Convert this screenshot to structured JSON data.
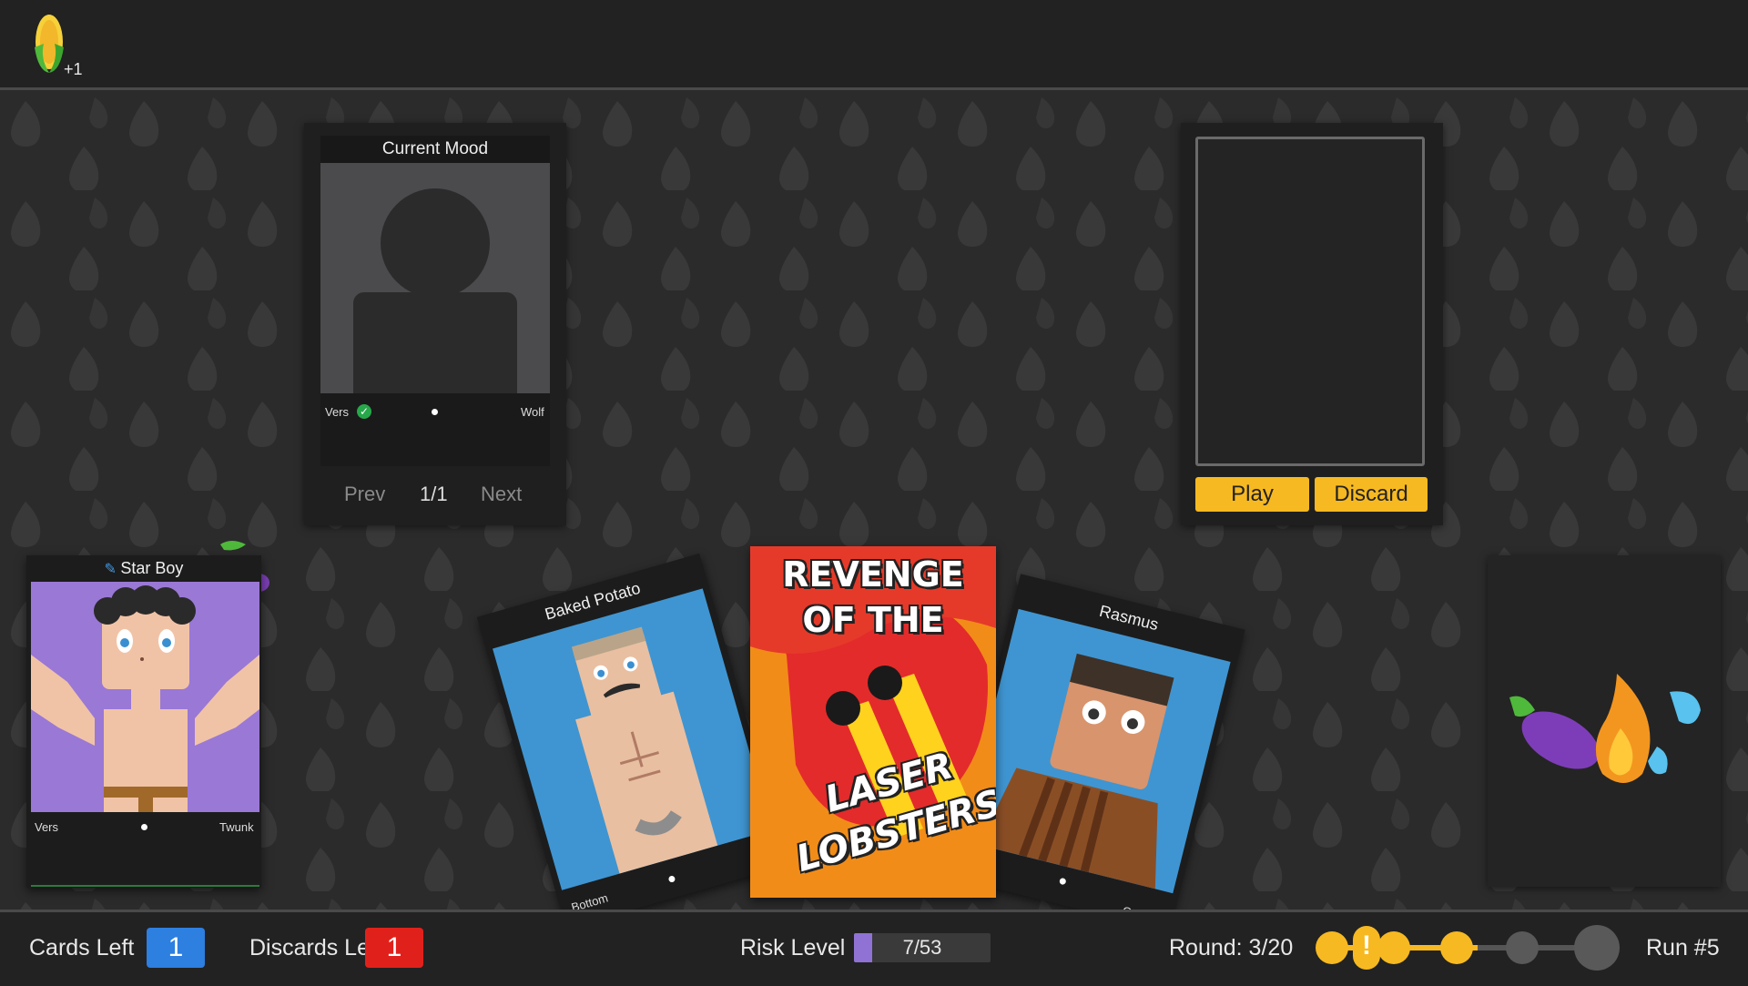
{
  "header": {
    "currency_icon": "corn-icon",
    "currency_bonus": "+1"
  },
  "mood_panel": {
    "title": "Current Mood",
    "stat_left": "Vers",
    "stat_left_icon": "checkmark-icon",
    "stat_right": "Wolf",
    "prev_label": "Prev",
    "page": "1/1",
    "next_label": "Next"
  },
  "play_panel": {
    "play_label": "Play",
    "discard_label": "Discard"
  },
  "star_card": {
    "icon": "pen-icon",
    "name": "Star Boy",
    "stat_left": "Vers",
    "stat_right": "Twunk",
    "accent": "#9a78d6"
  },
  "hand": {
    "cards": [
      {
        "name": "Baked Potato",
        "stat": "Bottom",
        "bg": "#3f95d1"
      },
      {
        "name": "REVENGE OF THE LASER LOBSTERS!",
        "title_top": "REVENGE OF THE",
        "title_bottom_1": "LASER",
        "title_bottom_2": "LOBSTERS!"
      },
      {
        "name": "Rasmus",
        "stat": "Otter",
        "bg": "#3f95d1"
      }
    ]
  },
  "deck_icons": [
    "eggplant-icon",
    "fire-icon",
    "droplets-icon"
  ],
  "footer": {
    "cards_left_label": "Cards Left",
    "cards_left_value": "1",
    "discards_left_label": "Discards Left",
    "discards_left_value": "1",
    "risk_label": "Risk Level",
    "risk_value": "7/53",
    "risk_fraction": 0.132,
    "round_label": "Round: 3/20",
    "run_label": "Run #5",
    "colors": {
      "blue": "#2d7fe0",
      "red": "#e0211b",
      "gold": "#f7b921",
      "purple": "#8f72d4"
    }
  }
}
